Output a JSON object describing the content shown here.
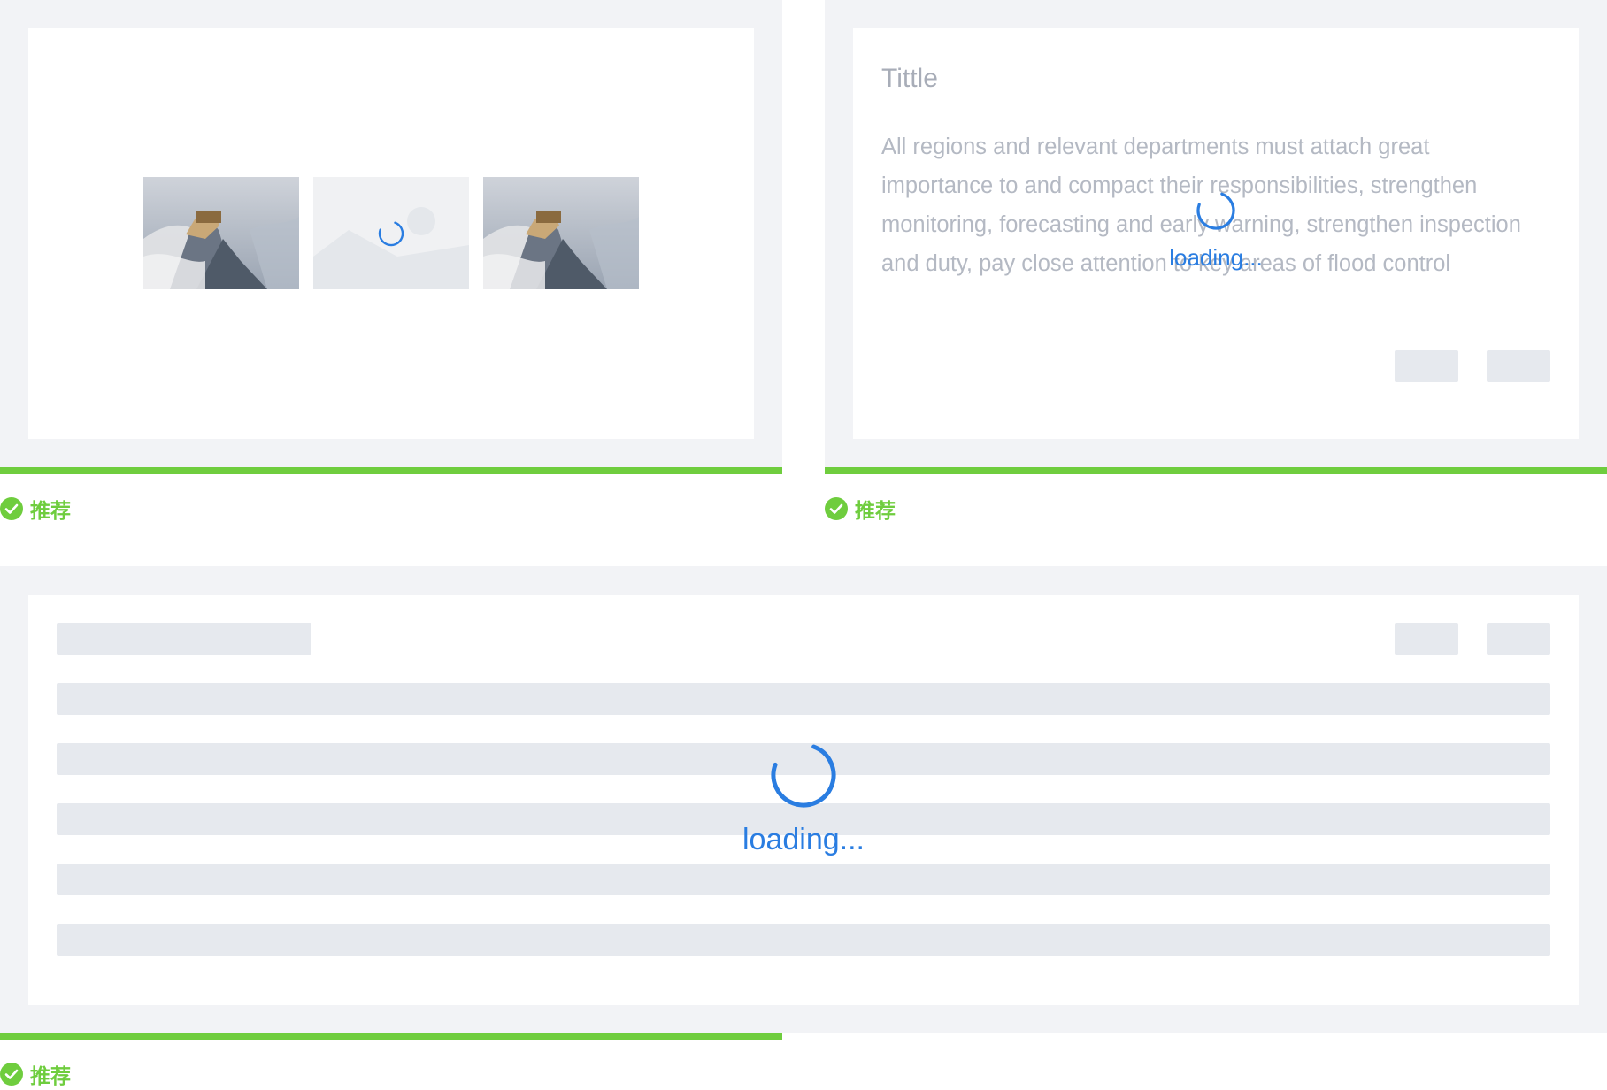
{
  "labels": {
    "recommend": "推荐"
  },
  "card_text": {
    "title": "Tittle",
    "body": "All regions and relevant departments must attach great importance to and compact their responsibilities, strengthen monitoring, forecasting and early warning, strengthen inspection and duty, pay close attention to key areas of flood control"
  },
  "loading": {
    "label": "loading..."
  },
  "colors": {
    "accent": "#2a7de1",
    "success": "#6fcd3e",
    "panel_bg": "#f2f3f6",
    "skeleton": "#e6e9ee"
  },
  "icons": {
    "recommend": "check-circle-icon",
    "placeholder": "image-placeholder-icon",
    "loading": "spinner-icon"
  }
}
